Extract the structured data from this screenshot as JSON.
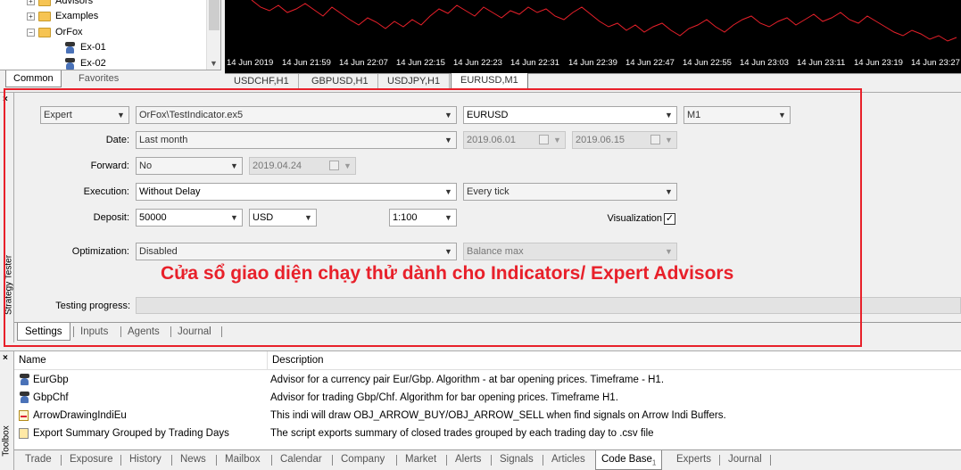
{
  "navigator": {
    "items": [
      {
        "label": "Advisors",
        "expand": "+"
      },
      {
        "label": "Examples",
        "expand": "+"
      },
      {
        "label": "OrFox",
        "expand": "−"
      },
      {
        "label": "Ex-01"
      },
      {
        "label": "Ex-02"
      }
    ],
    "tabs": {
      "common": "Common",
      "favorites": "Favorites"
    }
  },
  "chart": {
    "time_labels": [
      "14 Jun 2019",
      "14 Jun 21:59",
      "14 Jun 22:07",
      "14 Jun 22:15",
      "14 Jun 22:23",
      "14 Jun 22:31",
      "14 Jun 22:39",
      "14 Jun 22:47",
      "14 Jun 22:55",
      "14 Jun 23:03",
      "14 Jun 23:11",
      "14 Jun 23:19",
      "14 Jun 23:27"
    ],
    "line_color": "#e8202a",
    "tabs": [
      "USDCHF,H1",
      "GBPUSD,H1",
      "USDJPY,H1",
      "EURUSD,M1"
    ],
    "active_tab": "EURUSD,M1"
  },
  "tester": {
    "title": "Strategy Tester",
    "close": "×",
    "type": "Expert",
    "expert": "OrFox\\TestIndicator.ex5",
    "symbol": "EURUSD",
    "period": "M1",
    "date_label": "Date:",
    "date_value": "Last month",
    "date_from": "2019.06.01",
    "date_to": "2019.06.15",
    "forward_label": "Forward:",
    "forward_value": "No",
    "forward_date": "2019.04.24",
    "execution_label": "Execution:",
    "execution_value": "Without Delay",
    "model": "Every tick",
    "deposit_label": "Deposit:",
    "deposit_value": "50000",
    "currency": "USD",
    "leverage": "1:100",
    "visualization_label": "Visualization",
    "visualization_checked": "✓",
    "optimization_label": "Optimization:",
    "optimization_value": "Disabled",
    "optimization_criterion": "Balance max",
    "progress_label": "Testing progress:",
    "tabs": [
      "Settings",
      "Inputs",
      "Agents",
      "Journal"
    ]
  },
  "annotation": {
    "text": "Cửa sổ giao diện chạy thử dành cho Indicators/ Expert Advisors",
    "color": "#e8202a"
  },
  "toolbox": {
    "title": "Toolbox",
    "close": "×",
    "columns": {
      "name": "Name",
      "description": "Description"
    },
    "rows": [
      {
        "name": "EurGbp",
        "description": "Advisor for a currency pair Eur/Gbp. Algorithm - at bar opening prices. Timeframe - H1.",
        "icon": "expert-advisor-icon"
      },
      {
        "name": "GbpChf",
        "description": "Advisor for trading Gbp/Chf. Algorithm for bar opening prices. Timeframe H1.",
        "icon": "expert-advisor-icon"
      },
      {
        "name": "ArrowDrawingIndiEu",
        "description": "This indi will draw OBJ_ARROW_BUY/OBJ_ARROW_SELL when find signals on Arrow Indi Buffers.",
        "icon": "indicator-icon"
      },
      {
        "name": "Export Summary Grouped by Trading Days",
        "description": "The script exports summary of closed trades grouped by each trading day to .csv file",
        "icon": "script-icon"
      }
    ],
    "tabs": [
      "Trade",
      "Exposure",
      "History",
      "News",
      "Mailbox",
      "Calendar",
      "Company",
      "Market",
      "Alerts",
      "Signals",
      "Articles",
      "Code Base",
      "Experts",
      "Journal"
    ],
    "active_tab": "Code Base",
    "code_base_count": "1"
  }
}
